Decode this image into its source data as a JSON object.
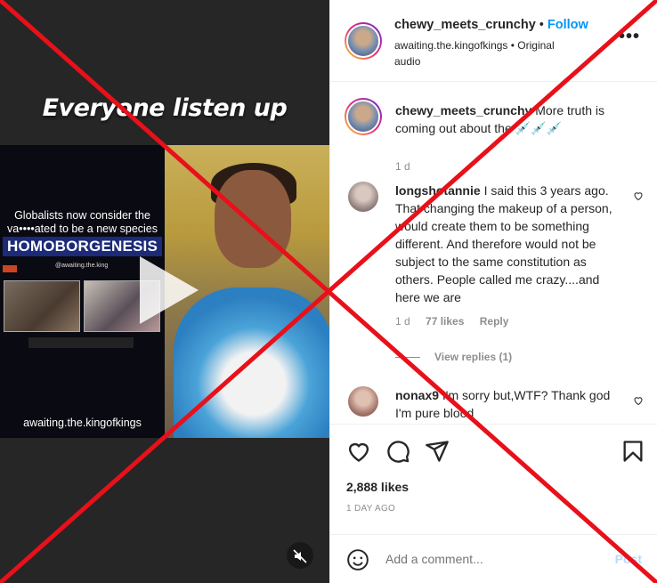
{
  "video": {
    "caption": "Everyone listen up",
    "inset_title": "Globalists now consider the va••••ated to be a new species",
    "inset_headline": "HOMOBORGENESIS",
    "inset_handle": "@awaiting.the.king",
    "inset_url": "awaiting.the.kingofkings"
  },
  "header": {
    "username": "chewy_meets_crunchy",
    "follow_label": "Follow",
    "audio_line": "awaiting.the.kingofkings • Original audio"
  },
  "comments": [
    {
      "username": "chewy_meets_crunchy",
      "text": "More truth is coming out about the 💉💉💉",
      "time": "1 d"
    },
    {
      "username": "longshotannie",
      "text": "I said this 3 years ago. That changing the makeup of a person, would create them to be something different. And therefore would not be subject to the same constitution as others. People called me crazy....and here we are",
      "time": "1 d",
      "likes": "77 likes",
      "reply": "Reply",
      "view_replies": "View replies (1)"
    },
    {
      "username": "nonax9",
      "text": "I'm sorry but,WTF? Thank god I'm pure blood"
    }
  ],
  "post": {
    "likes": "2,888 likes",
    "date": "1 DAY AGO"
  },
  "add_comment": {
    "placeholder": "Add a comment...",
    "post_label": "Post"
  },
  "colors": {
    "follow": "#0095f6",
    "overlay_cross": "#e8101a"
  }
}
